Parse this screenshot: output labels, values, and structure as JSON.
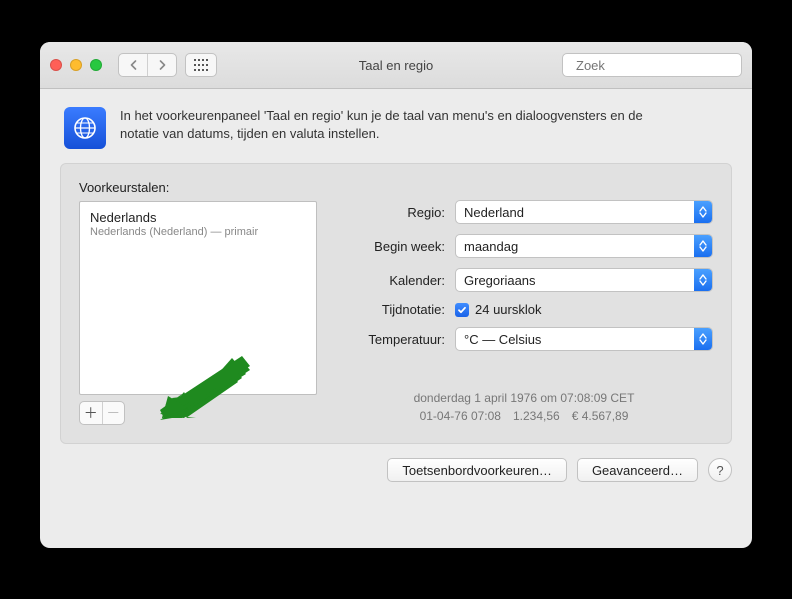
{
  "window": {
    "title": "Taal en regio",
    "search_placeholder": "Zoek"
  },
  "info": {
    "line1": "In het voorkeurenpaneel 'Taal en regio' kun je de taal van menu's en dialoogvensters en de",
    "line2": "notatie van datums, tijden en valuta instellen."
  },
  "languages": {
    "heading": "Voorkeurstalen:",
    "items": [
      {
        "name": "Nederlands",
        "detail": "Nederlands (Nederland) — primair"
      }
    ]
  },
  "settings": {
    "region_label": "Regio:",
    "region_value": "Nederland",
    "week_label": "Begin week:",
    "week_value": "maandag",
    "calendar_label": "Kalender:",
    "calendar_value": "Gregoriaans",
    "time_label": "Tijdnotatie:",
    "time_check_label": "24 uursklok",
    "temperature_label": "Temperatuur:",
    "temperature_value": "°C — Celsius"
  },
  "samples": {
    "line1": "donderdag 1 april 1976 om 07:08:09 CET",
    "line2": "01-04-76 07:08 1.234,56 € 4.567,89"
  },
  "buttons": {
    "keyboard": "Toetsenbordvoorkeuren…",
    "advanced": "Geavanceerd…",
    "help": "?"
  }
}
